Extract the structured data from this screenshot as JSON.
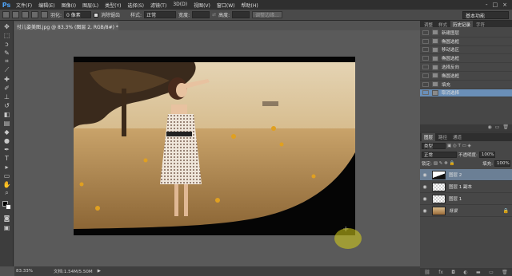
{
  "app": {
    "logo": "Ps"
  },
  "menu": [
    "文件(F)",
    "编辑(E)",
    "图像(I)",
    "图层(L)",
    "类型(Y)",
    "选择(S)",
    "滤镜(T)",
    "3D(D)",
    "视图(V)",
    "窗口(W)",
    "帮助(H)"
  ],
  "window_controls": [
    "-",
    "□",
    "×"
  ],
  "options": {
    "feather_label": "羽化:",
    "feather_value": "0 像素",
    "antialias_label": "消除锯齿",
    "style_label": "样式:",
    "style_value": "正常",
    "width_label": "宽度:",
    "height_label": "高度:",
    "refine_button": "调整边缘...",
    "workspace": "基本功能"
  },
  "document": {
    "tab_title": "付儿姿美图.jpg @ 83.3% (图层 2, RGB/8#) *",
    "zoom": "83.33%",
    "doc_size": "文档:1.54M/5.50M"
  },
  "history": {
    "tabs": [
      "调整",
      "样式",
      "历史记录",
      "字符"
    ],
    "items": [
      {
        "label": "新建图层",
        "selected": false
      },
      {
        "label": "椭圆选框",
        "selected": false
      },
      {
        "label": "移动选区",
        "selected": false
      },
      {
        "label": "椭圆选框",
        "selected": false
      },
      {
        "label": "选择反向",
        "selected": false
      },
      {
        "label": "椭圆选框",
        "selected": false
      },
      {
        "label": "填充",
        "selected": false
      },
      {
        "label": "取消选择",
        "selected": true
      }
    ]
  },
  "layers": {
    "tabs": [
      "图层",
      "路径",
      "通道"
    ],
    "filter_label": "类型",
    "blend_mode": "正常",
    "opacity_label": "不透明度:",
    "opacity_value": "100%",
    "lock_label": "锁定:",
    "fill_label": "填充:",
    "fill_value": "100%",
    "items": [
      {
        "name": "图层 2",
        "selected": true,
        "thumb": "white-curve"
      },
      {
        "name": "图层 1 副本",
        "selected": false,
        "thumb": "checker"
      },
      {
        "name": "图层 1",
        "selected": false,
        "thumb": "checker"
      },
      {
        "name": "背景",
        "selected": false,
        "thumb": "photo",
        "italic": true
      }
    ]
  },
  "colors": {
    "accent": "#6a8fb8",
    "photo_tone": "#c9a56e",
    "selection_hl": "#d8d21a"
  }
}
